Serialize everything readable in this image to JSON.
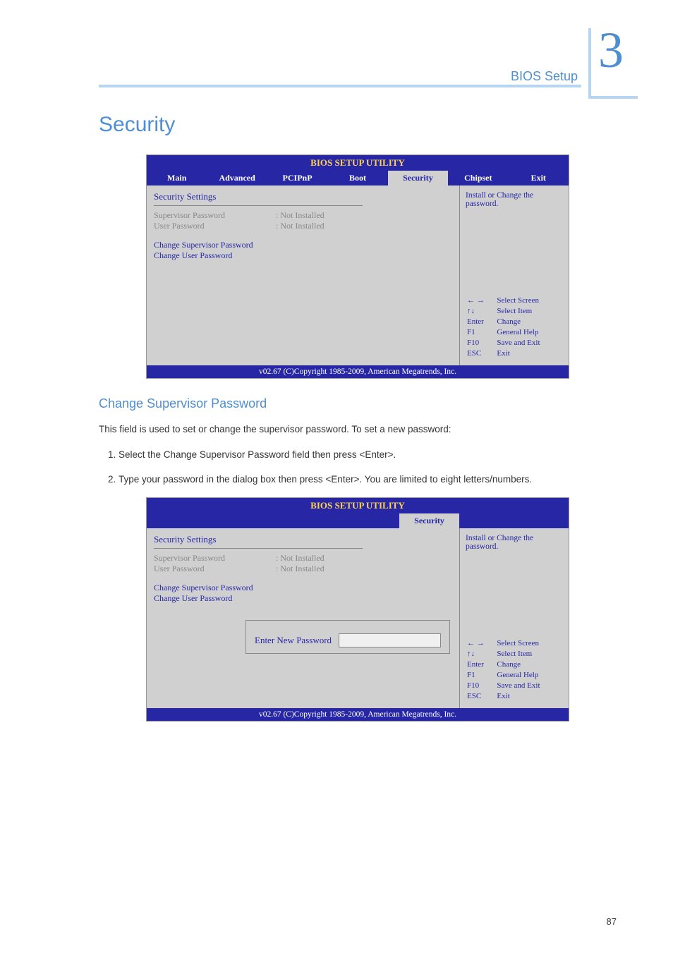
{
  "header": {
    "chapter_number": "3",
    "chapter_label": "BIOS Setup"
  },
  "section_title": "Security",
  "bios1": {
    "title": "BIOS SETUP UTILITY",
    "tabs": [
      "Main",
      "Advanced",
      "PCIPnP",
      "Boot",
      "Security",
      "Chipset",
      "Exit"
    ],
    "active_tab_index": 4,
    "left": {
      "heading": "Security Settings",
      "rows": [
        {
          "label": "Supervisor Password",
          "value": ": Not Installed"
        },
        {
          "label": "User Password",
          "value": ": Not Installed"
        }
      ],
      "actions": [
        "Change Supervisor Password",
        "Change User Password"
      ]
    },
    "right": {
      "help_text": "Install or Change the password.",
      "keys": [
        {
          "k": "← →",
          "v": "Select Screen"
        },
        {
          "k": "↑↓",
          "v": "Select Item"
        },
        {
          "k": "Enter",
          "v": "Change"
        },
        {
          "k": "F1",
          "v": "General Help"
        },
        {
          "k": "F10",
          "v": "Save and Exit"
        },
        {
          "k": "ESC",
          "v": "Exit"
        }
      ]
    },
    "footer": "v02.67 (C)Copyright 1985-2009, American Megatrends, Inc."
  },
  "subsection": {
    "title": "Change Supervisor Password",
    "intro": "This field is used to set or change the supervisor password. To set a new password:",
    "steps": [
      "Select the Change Supervisor Password field then press <Enter>.",
      "Type your password in the dialog box then press <Enter>. You are limited to eight letters/numbers."
    ]
  },
  "bios2": {
    "title": "BIOS SETUP UTILITY",
    "active_tab": "Security",
    "left": {
      "heading": "Security Settings",
      "rows": [
        {
          "label": "Supervisor Password",
          "value": ": Not Installed"
        },
        {
          "label": "User Password",
          "value": ": Not Installed"
        }
      ],
      "actions": [
        "Change Supervisor Password",
        "Change User Password"
      ]
    },
    "dialog_label": "Enter New Password",
    "right": {
      "help_text": "Install or Change the password.",
      "keys": [
        {
          "k": "← →",
          "v": "Select Screen"
        },
        {
          "k": "↑↓",
          "v": "Select Item"
        },
        {
          "k": "Enter",
          "v": "Change"
        },
        {
          "k": "F1",
          "v": "General Help"
        },
        {
          "k": "F10",
          "v": "Save and Exit"
        },
        {
          "k": "ESC",
          "v": "Exit"
        }
      ]
    },
    "footer": "v02.67 (C)Copyright 1985-2009, American Megatrends, Inc."
  },
  "page_number": "87"
}
